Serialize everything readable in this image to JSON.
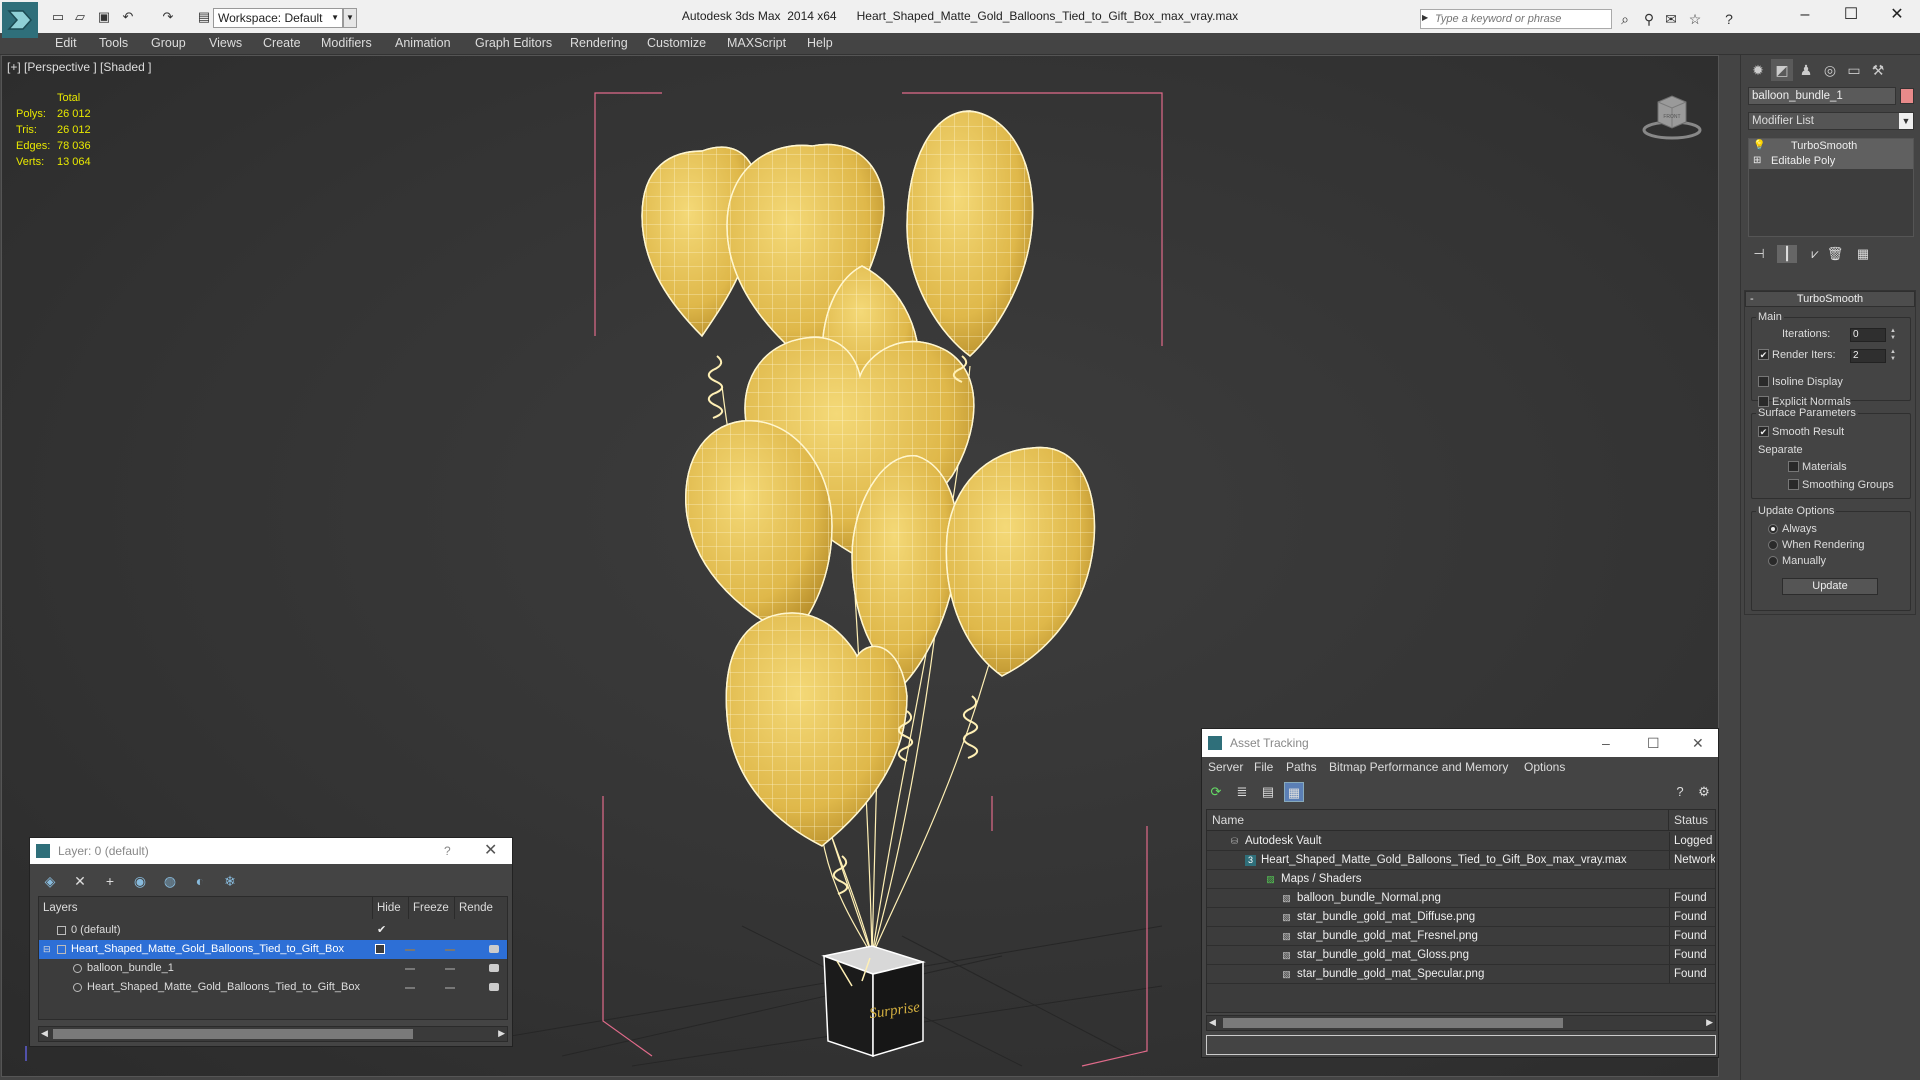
{
  "window": {
    "app_title": "Autodesk 3ds Max  2014 x64",
    "file_title": "Heart_Shaped_Matte_Gold_Balloons_Tied_to_Gift_Box_max_vray.max",
    "workspace": "Workspace: Default",
    "search_placeholder": "Type a keyword or phrase"
  },
  "menu": [
    "Edit",
    "Tools",
    "Group",
    "Views",
    "Create",
    "Modifiers",
    "Animation",
    "Graph Editors",
    "Rendering",
    "Customize",
    "MAXScript",
    "Help"
  ],
  "viewport": {
    "label": "[+] [Perspective ] [Shaded ]",
    "stats_header": "Total",
    "stats": [
      {
        "label": "Polys:",
        "value": "26 012"
      },
      {
        "label": "Tris:",
        "value": "26 012"
      },
      {
        "label": "Edges:",
        "value": "78 036"
      },
      {
        "label": "Verts:",
        "value": "13 064"
      }
    ],
    "box_label": "Surprise",
    "viewcube_label": "FRONT"
  },
  "command_panel": {
    "object_name": "balloon_bundle_1",
    "object_color": "#e88a8a",
    "modifier_list": "Modifier List",
    "stack": [
      "TurboSmooth",
      "Editable Poly"
    ],
    "rollout_title": "TurboSmooth",
    "main_group": "Main",
    "iterations_label": "Iterations:",
    "iterations_value": "0",
    "render_iters_label": "Render Iters:",
    "render_iters_value": "2",
    "isoline_label": "Isoline Display",
    "explicit_normals_label": "Explicit Normals",
    "surface_group": "Surface Parameters",
    "smooth_result_label": "Smooth Result",
    "separate_label": "Separate",
    "materials_label": "Materials",
    "smoothing_groups_label": "Smoothing Groups",
    "update_group": "Update Options",
    "always_label": "Always",
    "when_rendering_label": "When Rendering",
    "manually_label": "Manually",
    "update_button": "Update"
  },
  "layer_explorer": {
    "title": "Layer: 0 (default)",
    "help": "?",
    "columns": [
      "Layers",
      "Hide",
      "Freeze",
      "Rende"
    ],
    "rows": [
      {
        "name": "0 (default)"
      },
      {
        "name": "Heart_Shaped_Matte_Gold_Balloons_Tied_to_Gift_Box"
      },
      {
        "name": "balloon_bundle_1"
      },
      {
        "name": "Heart_Shaped_Matte_Gold_Balloons_Tied_to_Gift_Box"
      }
    ]
  },
  "asset_tracking": {
    "title": "Asset Tracking",
    "menu": [
      "Server",
      "File",
      "Paths",
      "Bitmap Performance and Memory",
      "Options"
    ],
    "columns": [
      "Name",
      "Status"
    ],
    "rows": [
      {
        "name": "Autodesk Vault",
        "status": "Logged C"
      },
      {
        "name": "Heart_Shaped_Matte_Gold_Balloons_Tied_to_Gift_Box_max_vray.max",
        "status": "Network"
      },
      {
        "name": "Maps / Shaders",
        "status": ""
      },
      {
        "name": "balloon_bundle_Normal.png",
        "status": "Found"
      },
      {
        "name": "star_bundle_gold_mat_Diffuse.png",
        "status": "Found"
      },
      {
        "name": "star_bundle_gold_mat_Fresnel.png",
        "status": "Found"
      },
      {
        "name": "star_bundle_gold_mat_Gloss.png",
        "status": "Found"
      },
      {
        "name": "star_bundle_gold_mat_Specular.png",
        "status": "Found"
      }
    ]
  },
  "colors": {
    "balloon": "#e6c255",
    "wire": "#fff2c0",
    "bbox": "#e06a8a",
    "selection": "#2d6fd6"
  }
}
